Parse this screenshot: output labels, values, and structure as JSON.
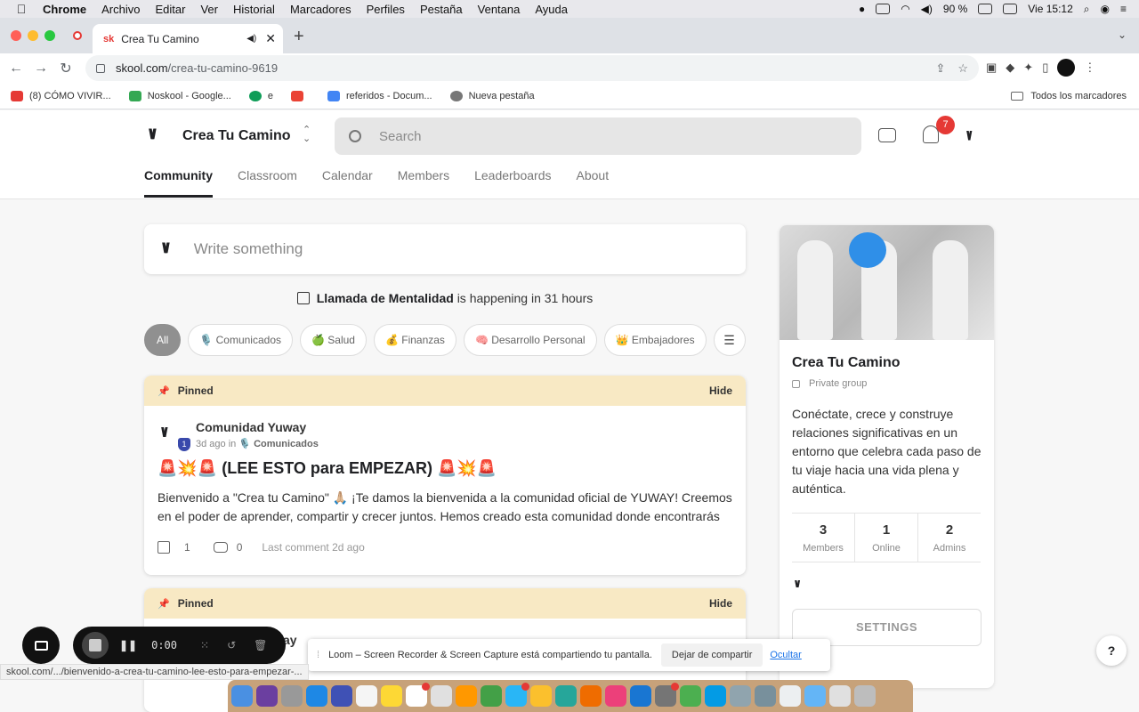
{
  "macos": {
    "menu": [
      "Chrome",
      "Archivo",
      "Editar",
      "Ver",
      "Historial",
      "Marcadores",
      "Perfiles",
      "Pestaña",
      "Ventana",
      "Ayuda"
    ],
    "battery": "90 %",
    "clock": "Vie 15:12"
  },
  "browser": {
    "tab_title": "Crea Tu Camino",
    "tab_favicon": "sk",
    "url_host": "skool.com",
    "url_path": "/crea-tu-camino-9619",
    "bookmarks": [
      "(8) CÓMO VIVIR...",
      "Noskool - Google...",
      "e",
      "",
      "referidos - Docum...",
      "Nueva pestaña"
    ],
    "bookmarks_all": "Todos los marcadores",
    "status_url": "skool.com/.../bienvenido-a-crea-tu-camino-lee-esto-para-empezar-..."
  },
  "header": {
    "community_name": "Crea Tu Camino",
    "search_placeholder": "Search",
    "notifications_count": "7",
    "tabs": [
      "Community",
      "Classroom",
      "Calendar",
      "Members",
      "Leaderboards",
      "About"
    ],
    "active_tab": "Community"
  },
  "feed": {
    "composer_placeholder": "Write something",
    "event_name": "Llamada de Mentalidad",
    "event_suffix": "is happening in 31 hours",
    "categories": [
      "All",
      "🎙️ Comunicados",
      "🍏 Salud",
      "💰 Finanzas",
      "🧠 Desarrollo Personal",
      "👑 Embajadores"
    ],
    "posts": [
      {
        "pinned_label": "Pinned",
        "hide_label": "Hide",
        "author": "Comunidad Yuway",
        "level": "1",
        "time": "3d ago in",
        "category": "🎙️ Comunicados",
        "title": "🚨💥🚨 (LEE ESTO para EMPEZAR) 🚨💥🚨",
        "body": "Bienvenido a \"Crea tu Camino\" 🙏🏼 ¡Te damos la bienvenida a la comunidad oficial de YUWAY! Creemos en el poder de aprender, compartir y crecer juntos. Hemos creado esta comunidad donde encontrarás",
        "likes": "1",
        "comments": "0",
        "last_comment": "Last comment 2d ago"
      },
      {
        "pinned_label": "Pinned",
        "hide_label": "Hide",
        "author": "ay"
      }
    ]
  },
  "sidebar": {
    "name": "Crea Tu Camino",
    "type": "Private group",
    "description": "Conéctate, crece y construye relaciones significativas en un entorno que celebra cada paso de tu viaje hacia una vida plena y auténtica.",
    "stats": [
      {
        "value": "3",
        "label": "Members"
      },
      {
        "value": "1",
        "label": "Online"
      },
      {
        "value": "2",
        "label": "Admins"
      }
    ],
    "settings_label": "SETTINGS"
  },
  "loom": {
    "timer": "0:00",
    "share_message": "Loom – Screen Recorder & Screen Capture está compartiendo tu pantalla.",
    "stop_sharing": "Dejar de compartir",
    "hide": "Ocultar"
  },
  "help_label": "?"
}
